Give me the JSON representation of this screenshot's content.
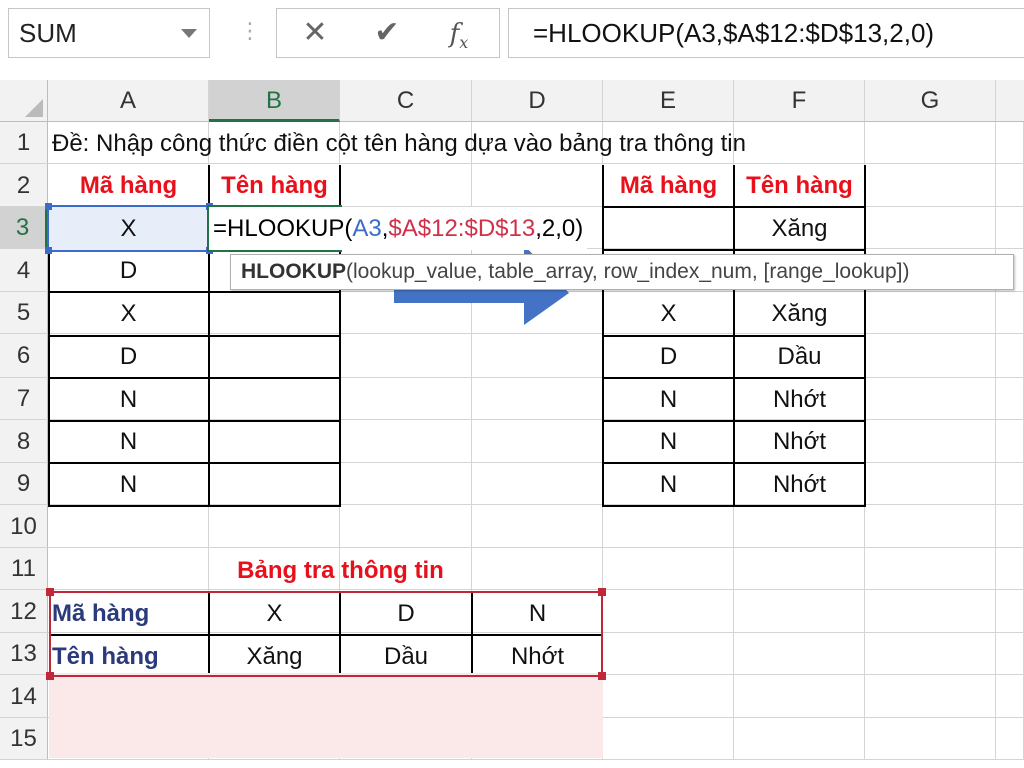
{
  "formula_bar": {
    "name_box": "SUM",
    "cancel_glyph": "✕",
    "enter_glyph": "✔",
    "fx_label": "f",
    "fx_sub": "x",
    "formula": "=HLOOKUP(A3,$A$12:$D$13,2,0)"
  },
  "columns": [
    "A",
    "B",
    "C",
    "D",
    "E",
    "F",
    "G"
  ],
  "rows": [
    "1",
    "2",
    "3",
    "4",
    "5",
    "6",
    "7",
    "8",
    "9",
    "10",
    "11",
    "12",
    "13",
    "14",
    "15"
  ],
  "cells": {
    "A1": "Đề: Nhập công thức điền cột tên hàng dựa vào bảng tra thông tin",
    "A2": "Mã hàng",
    "B2": "Tên hàng",
    "A3": "X",
    "A4": "D",
    "A5": "X",
    "A6": "D",
    "A7": "N",
    "A8": "N",
    "A9": "N",
    "E2": "Mã hàng",
    "F2": "Tên hàng",
    "F3": "Xăng",
    "E5": "X",
    "F5": "Xăng",
    "E6": "D",
    "F6": "Dầu",
    "E7": "N",
    "F7": "Nhớt",
    "E8": "N",
    "F8": "Nhớt",
    "E9": "N",
    "F9": "Nhớt",
    "B11": "Bảng tra thông tin",
    "A12": "Mã hàng",
    "B12": "X",
    "C12": "D",
    "D12": "N",
    "A13": "Tên hàng",
    "B13": "Xăng",
    "C13": "Dầu",
    "D13": "Nhớt"
  },
  "editing": {
    "prefix": "=HLOOKUP(",
    "ref1": "A3",
    "sep1": ",",
    "ref2": "$A$12:$D$13",
    "suffix": ",2,0)"
  },
  "tooltip": {
    "func": "HLOOKUP",
    "args": "(lookup_value, table_array, row_index_num, [range_lookup])"
  },
  "colors": {
    "header_red": "#e8101a",
    "ref_blue": "#3b6ccc",
    "ref_red": "#d0304a",
    "lookup_fill": "#fbe9ea",
    "lookup_border": "#c0283a",
    "arrow_blue": "#4472c4",
    "excel_green": "#217346"
  }
}
